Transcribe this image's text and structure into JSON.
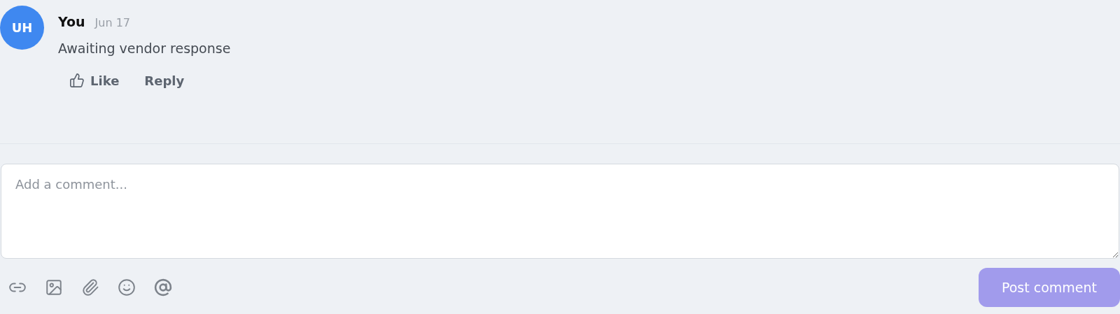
{
  "comment": {
    "avatar": "UH",
    "author": "You",
    "date": "Jun 17",
    "text": "Awaiting vendor response",
    "liked": false,
    "actions": {
      "like": "Like",
      "reply": "Reply"
    }
  },
  "composer": {
    "placeholder": "Add a comment...",
    "submit": {
      "label": "Post comment",
      "disabled": true
    }
  }
}
